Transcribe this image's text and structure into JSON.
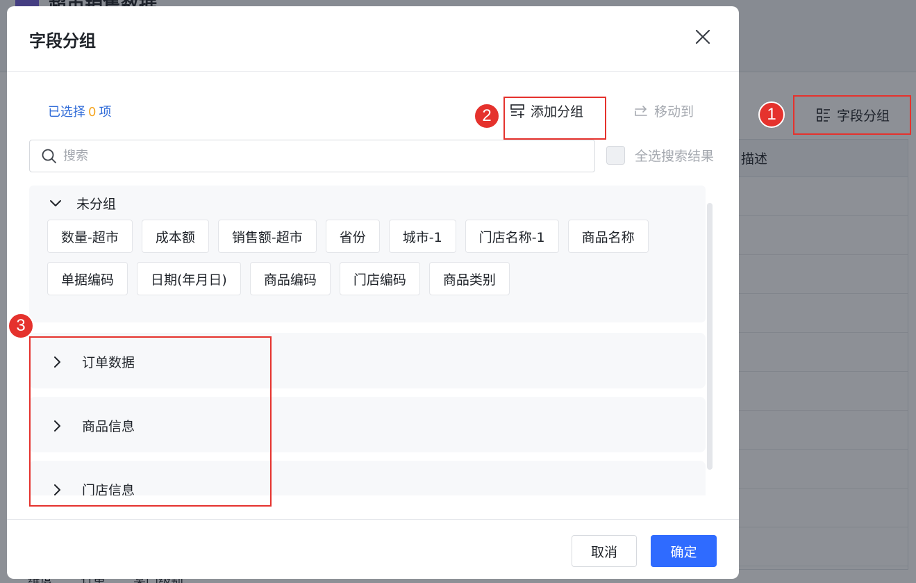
{
  "background": {
    "title": "超市销售数据",
    "field_group_label": "字段分组",
    "table_header": "描述",
    "bottom_row": [
      "维度",
      "订单",
      "某门级别"
    ]
  },
  "dialog": {
    "title": "字段分组",
    "selected_prefix": "已选择",
    "selected_count": "0",
    "selected_suffix": "项",
    "add_group_label": "添加分组",
    "move_to_label": "移动到",
    "search_placeholder": "搜索",
    "select_all_label": "全选搜索结果",
    "ungrouped": {
      "title": "未分组",
      "fields": [
        "数量-超市",
        "成本额",
        "销售额-超市",
        "省份",
        "城市-1",
        "门店名称-1",
        "商品名称",
        "单据编码",
        "日期(年月日)",
        "商品编码",
        "门店编码",
        "商品类别"
      ]
    },
    "groups": [
      {
        "title": "订单数据"
      },
      {
        "title": "商品信息"
      },
      {
        "title": "门店信息"
      }
    ],
    "cancel_label": "取消",
    "ok_label": "确定"
  },
  "annotations": {
    "badge_1": "1",
    "badge_2": "2",
    "badge_3": "3",
    "color": "#e5322d"
  },
  "colors": {
    "primary": "#2f6bff",
    "selected_text": "#2f6bd8",
    "count": "#f5a623"
  }
}
